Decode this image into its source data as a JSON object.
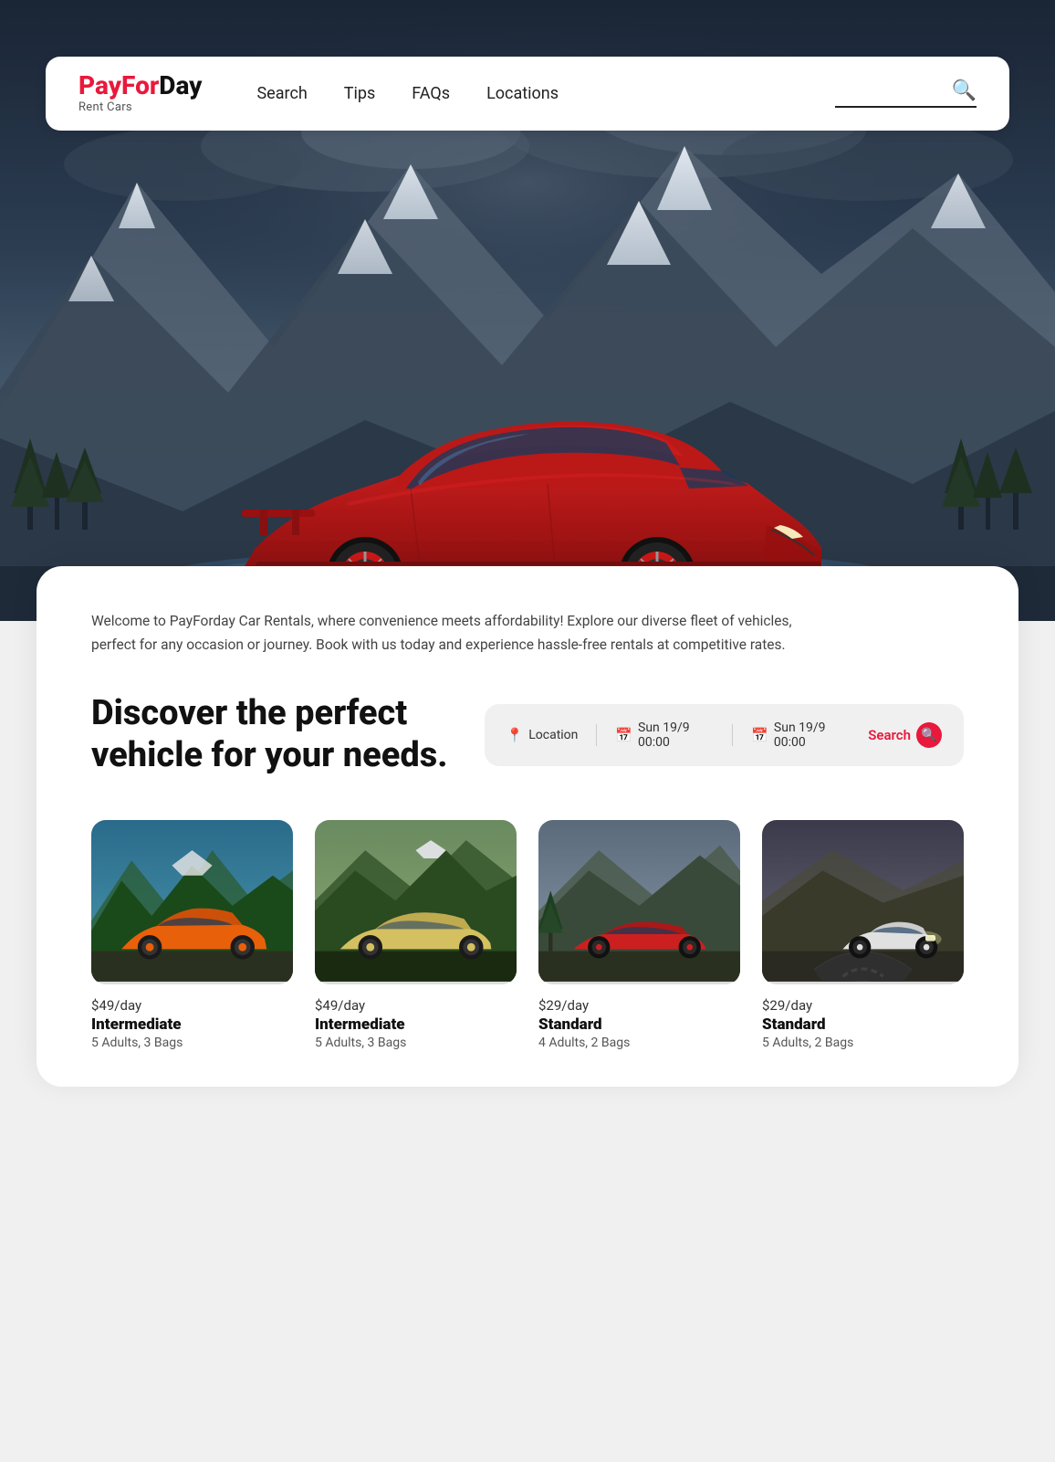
{
  "header": {
    "logo": {
      "pay": "Pay",
      "for": "For",
      "day": "Day",
      "sub": "Rent Cars"
    },
    "nav": [
      {
        "label": "Search",
        "id": "nav-search"
      },
      {
        "label": "Tips",
        "id": "nav-tips"
      },
      {
        "label": "FAQs",
        "id": "nav-faqs"
      },
      {
        "label": "Locations",
        "id": "nav-locations"
      }
    ],
    "search_placeholder": ""
  },
  "hero": {
    "alt": "Red sports car in mountain landscape"
  },
  "content": {
    "welcome": "Welcome to PayForday Car Rentals, where convenience meets affordability! Explore our diverse fleet of vehicles, perfect for any occasion or journey. Book with us today and experience hassle-free rentals at competitive rates.",
    "discover_line1": "Discover the perfect",
    "discover_line2": "vehicle for your needs."
  },
  "search_widget": {
    "location_label": "Location",
    "pickup_date": "Sun 19/9 00:00",
    "dropoff_date": "Sun 19/9 00:00",
    "search_label": "Search"
  },
  "cars": [
    {
      "price": "$49/day",
      "name": "Intermediate",
      "details": "5 Adults, 3 Bags",
      "color": "#e8500a",
      "bg": "#1a3a5c"
    },
    {
      "price": "$49/day",
      "name": "Intermediate",
      "details": "5 Adults, 3 Bags",
      "color": "#c8b820",
      "bg": "#2a4a2a"
    },
    {
      "price": "$29/day",
      "name": "Standard",
      "details": "4 Adults, 2 Bags",
      "color": "#cc2020",
      "bg": "#3a4a3a"
    },
    {
      "price": "$29/day",
      "name": "Standard",
      "details": "5 Adults, 2 Bags",
      "color": "#e0e0e0",
      "bg": "#2a2a2a"
    }
  ]
}
